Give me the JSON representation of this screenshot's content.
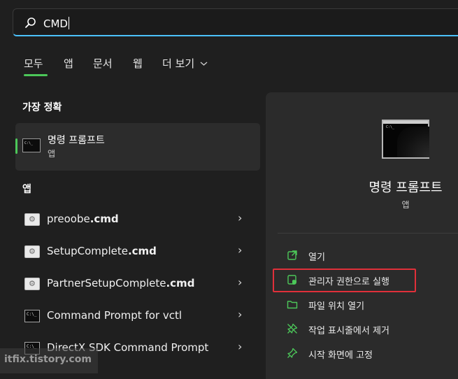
{
  "search": {
    "query": "CMD"
  },
  "tabs": [
    {
      "label": "모두",
      "active": true
    },
    {
      "label": "앱"
    },
    {
      "label": "문서"
    },
    {
      "label": "웹"
    },
    {
      "label": "더 보기"
    }
  ],
  "best_match": {
    "heading": "가장 정확",
    "title": "명령 프롬프트",
    "subtitle": "앱",
    "icon": "command-prompt-icon"
  },
  "apps": {
    "heading": "앱",
    "items": [
      {
        "name": "preoobe",
        "ext": ".cmd",
        "icon": "settings-script-icon"
      },
      {
        "name": "SetupComplete",
        "ext": ".cmd",
        "icon": "settings-script-icon"
      },
      {
        "name": "PartnerSetupComplete",
        "ext": ".cmd",
        "icon": "settings-script-icon"
      },
      {
        "name": "Command Prompt for vctl",
        "ext": "",
        "icon": "command-prompt-icon"
      },
      {
        "name": "DirectX SDK Command Prompt",
        "ext": "",
        "icon": "command-prompt-icon"
      }
    ]
  },
  "details": {
    "title": "명령 프롬프트",
    "subtitle": "앱",
    "actions": [
      {
        "label": "열기",
        "icon": "open-icon"
      },
      {
        "label": "관리자 권한으로 실행",
        "icon": "run-as-admin-icon",
        "highlighted": true
      },
      {
        "label": "파일 위치 열기",
        "icon": "folder-icon"
      },
      {
        "label": "작업 표시줄에서 제거",
        "icon": "unpin-icon"
      },
      {
        "label": "시작 화면에 고정",
        "icon": "pin-icon"
      }
    ]
  },
  "watermark": "itfix.tistory.com",
  "colors": {
    "accent_green": "#4cc759",
    "highlight_red": "#e0303a",
    "icon_green": "#4cc759"
  }
}
